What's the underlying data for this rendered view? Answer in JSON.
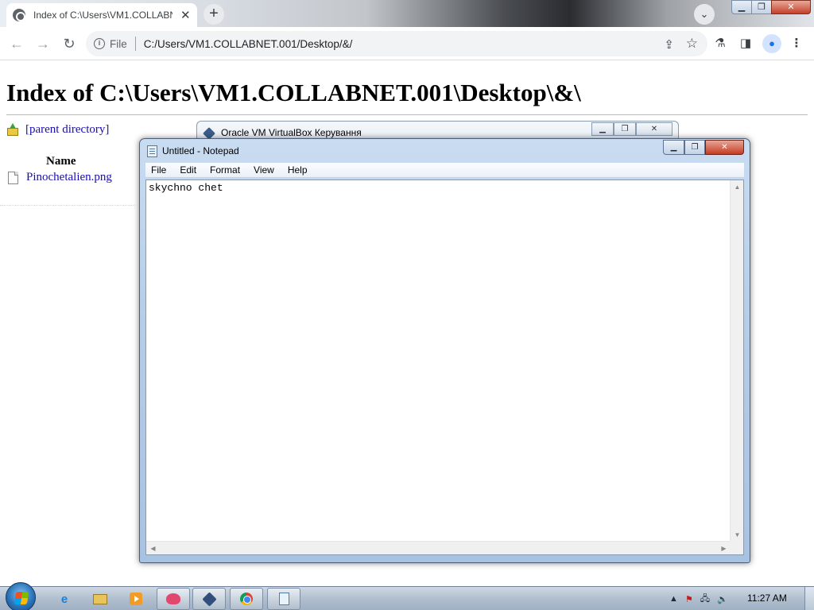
{
  "browser": {
    "tab_title": "Index of C:\\Users\\VM1.COLLABNET.001\\Desktop\\&\\",
    "url_scheme_label": "File",
    "url": "C:/Users/VM1.COLLABNET.001/Desktop/&/"
  },
  "page": {
    "heading": "Index of C:\\Users\\VM1.COLLABNET.001\\Desktop\\&\\",
    "parent_link": "[parent directory]",
    "column_name": "Name",
    "files": [
      "Pinochetalien.png"
    ]
  },
  "virtualbox": {
    "title": "Oracle VM VirtualBox Керування"
  },
  "notepad": {
    "title": "Untitled - Notepad",
    "menu": [
      "File",
      "Edit",
      "Format",
      "View",
      "Help"
    ],
    "content": "skychno chet"
  },
  "taskbar": {
    "clock": "11:27 AM",
    "items": [
      "start-button",
      "internet-explorer-icon",
      "windows-explorer-icon",
      "media-player-icon",
      "gitkraken-icon",
      "virtualbox-icon",
      "chrome-icon",
      "notepad-icon"
    ]
  },
  "colors": {
    "link": "#1a0dab",
    "window_close": "#c4412a"
  }
}
